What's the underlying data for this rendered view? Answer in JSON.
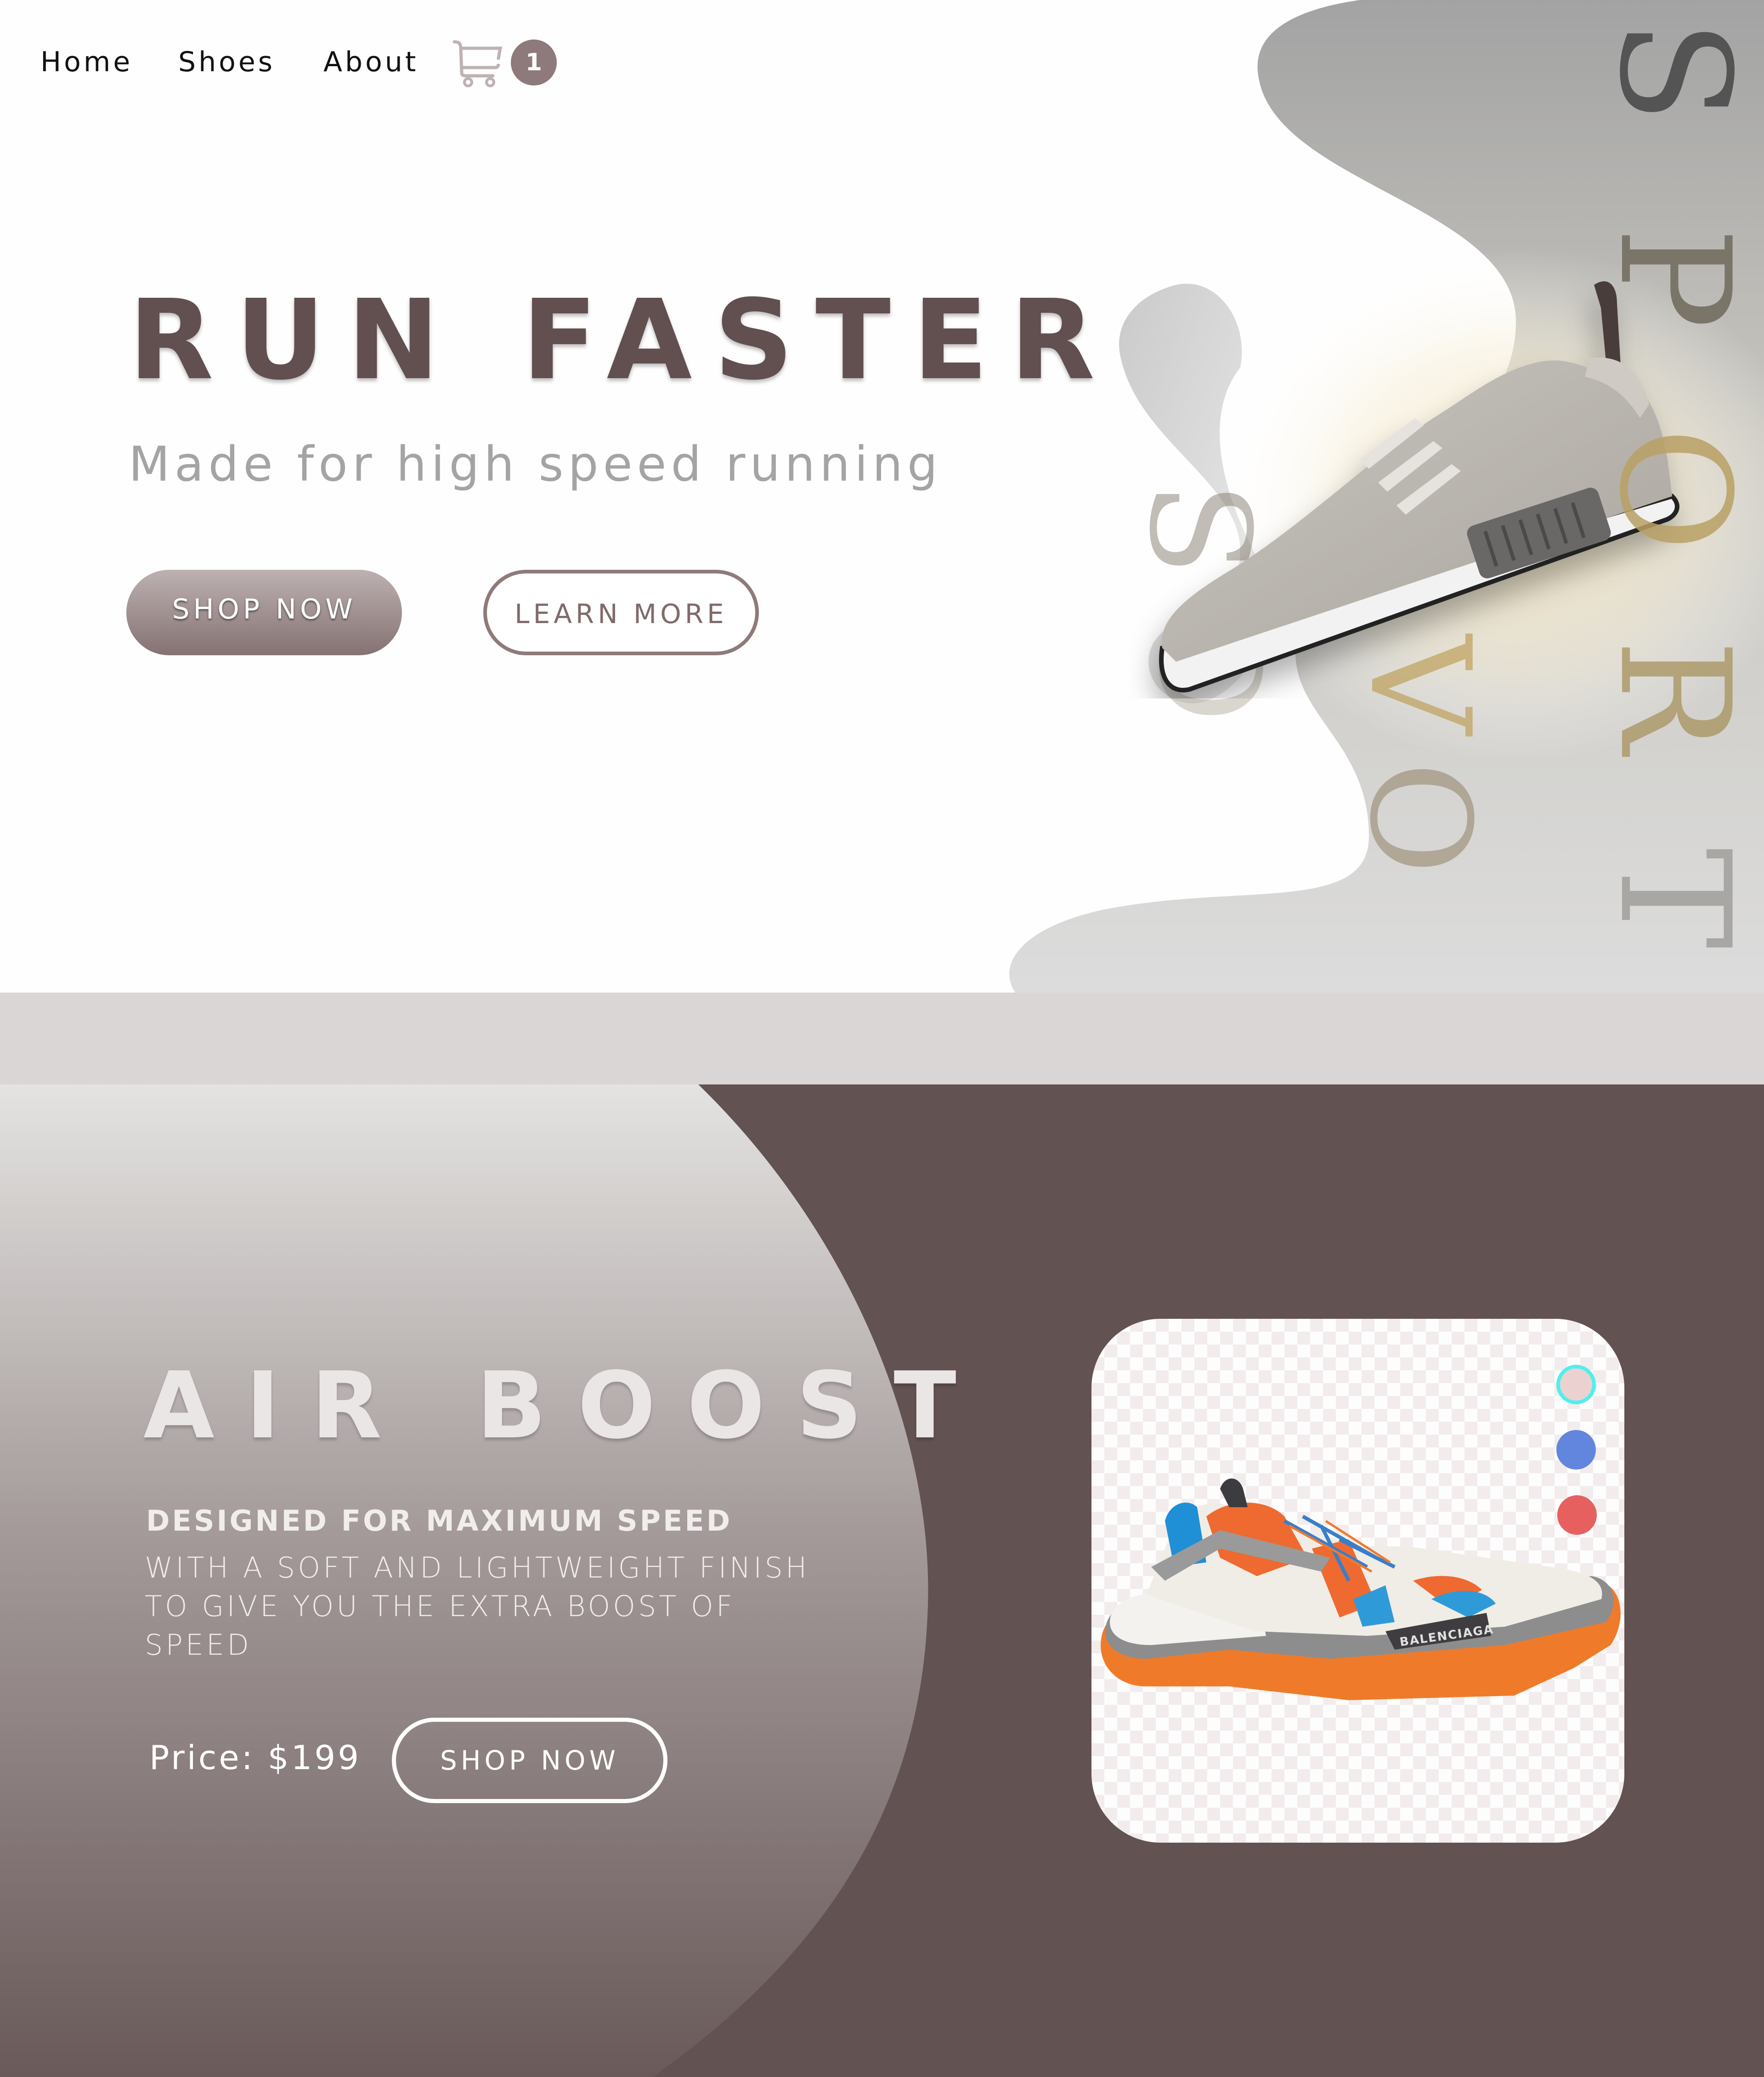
{
  "nav": {
    "items": [
      {
        "label": "Home"
      },
      {
        "label": "Shoes"
      },
      {
        "label": "About"
      }
    ],
    "cart": {
      "icon": "shopping-cart-icon",
      "count": "1"
    }
  },
  "hero": {
    "title": "RUN FASTER",
    "subtitle": "Made for high speed running",
    "primary_button": "SHOP NOW",
    "secondary_button": "LEARN MORE",
    "decor_word": "SPORT",
    "decor_letters": [
      "S",
      "P",
      "O",
      "R",
      "T"
    ],
    "ghost_letters": [
      "S",
      "O",
      "V",
      "O"
    ],
    "product_image": "grey-running-sneaker"
  },
  "boost": {
    "title": "AIR BOOST",
    "tagline": "DESIGNED FOR MAXIMUM SPEED",
    "description": "WITH A SOFT AND LIGHTWEIGHT FINISH TO GIVE YOU THE EXTRA BOOST OF SPEED",
    "price_label": "Price: $199",
    "button": "SHOP NOW",
    "product_image": "orange-blue-white-chunky-sneaker",
    "product_brand_text": "BALENCIAGA",
    "color_options": [
      {
        "name": "pink",
        "color": "#ecd1d1",
        "selected": true,
        "ring": "#4ff0ec"
      },
      {
        "name": "blue",
        "color": "#6286de",
        "selected": false
      },
      {
        "name": "red",
        "color": "#e66060",
        "selected": false
      }
    ]
  },
  "colors": {
    "brand_dark": "#624f4f",
    "section_bg": "#635252",
    "band": "#dbd6d6",
    "button_gradient_top": "#bdb1b1",
    "button_gradient_bottom": "#857272",
    "outline": "#8f7a7a"
  }
}
